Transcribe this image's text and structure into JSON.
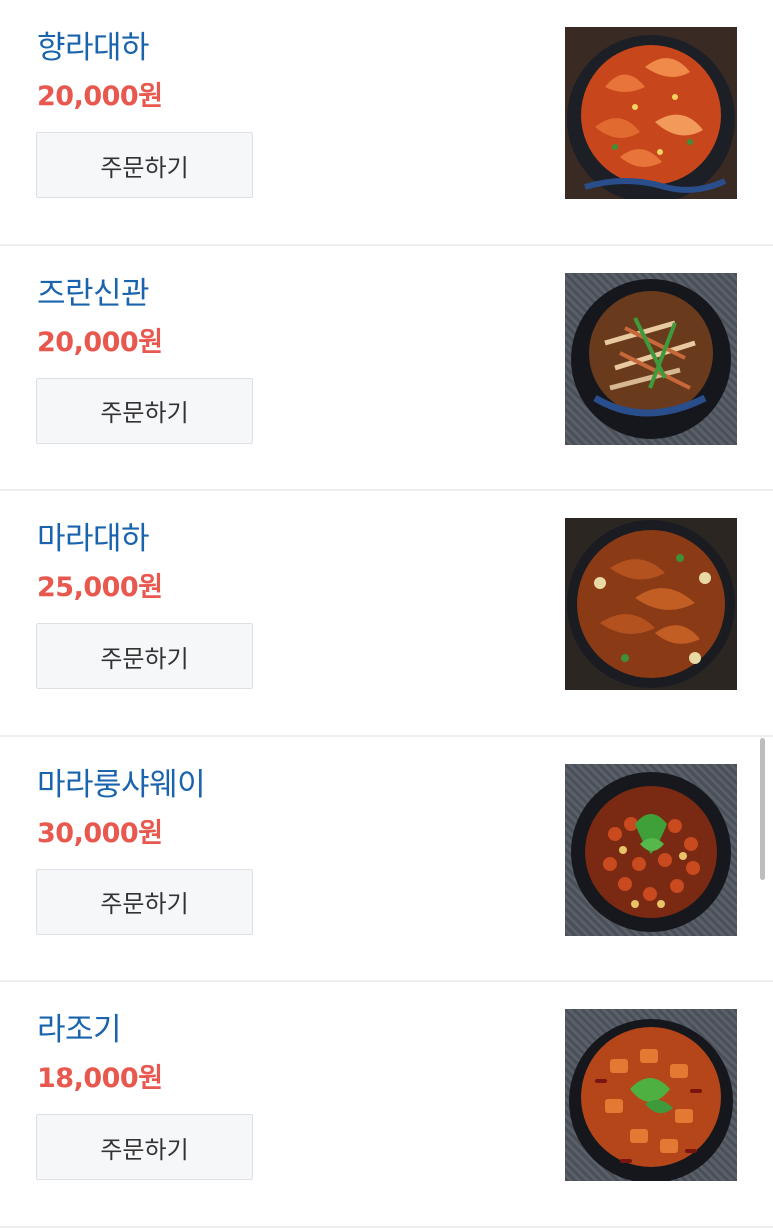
{
  "menu": {
    "items": [
      {
        "name": "향라대하",
        "price": "20,000원",
        "order_label": "주문하기",
        "image_icon": "spicy-shrimp-dish-icon"
      },
      {
        "name": "즈란신관",
        "price": "20,000원",
        "order_label": "주문하기",
        "image_icon": "stir-fried-squid-dish-icon"
      },
      {
        "name": "마라대하",
        "price": "25,000원",
        "order_label": "주문하기",
        "image_icon": "mala-shrimp-dish-icon"
      },
      {
        "name": "마라룽샤웨이",
        "price": "30,000원",
        "order_label": "주문하기",
        "image_icon": "mala-crayfish-dish-icon"
      },
      {
        "name": "라조기",
        "price": "18,000원",
        "order_label": "주문하기",
        "image_icon": "spicy-chicken-dish-icon"
      }
    ]
  },
  "colors": {
    "name": "#1a63ad",
    "price": "#e8584e",
    "button_bg": "#f6f7f9",
    "divider": "#eeeeee"
  }
}
